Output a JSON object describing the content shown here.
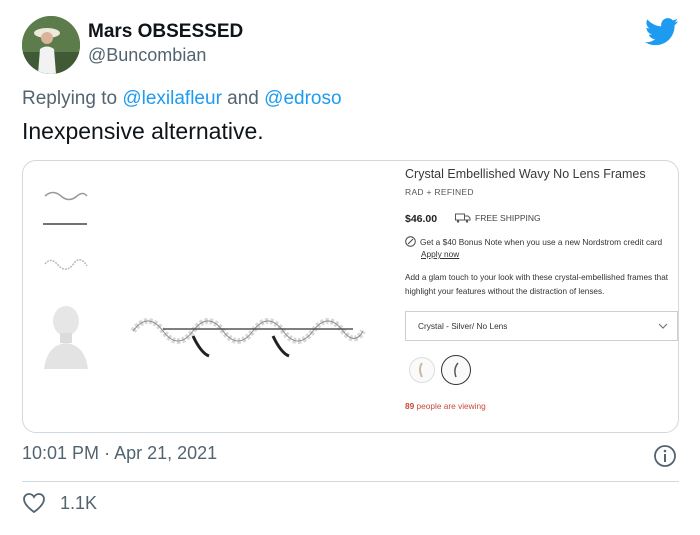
{
  "author": {
    "name": "Mars OBSESSED",
    "handle": "@Buncombian",
    "avatar_icon": "avatar-photo"
  },
  "reply": {
    "prefix": "Replying to",
    "mention1": "@lexilafleur",
    "joiner": "and",
    "mention2": "@edroso"
  },
  "tweet": {
    "text": "Inexpensive alternative."
  },
  "product": {
    "title": "Crystal Embellished Wavy No Lens Frames",
    "brand": "RAD + REFINED",
    "price": "$46.00",
    "shipping": "FREE SHIPPING",
    "bonus": "Get a $40 Bonus Note when you use a new Nordstrom credit card",
    "apply": "Apply now",
    "description": "Add a glam touch to your look with these crystal-embellished frames that highlight your features without the distraction of lenses.",
    "selected_option": "Crystal - Silver/ No Lens",
    "viewing_count": "89",
    "viewing_text": "people are viewing"
  },
  "meta": {
    "time": "10:01 PM",
    "separator": "·",
    "date": "Apr 21, 2021"
  },
  "actions": {
    "like_count": "1.1K"
  },
  "colors": {
    "accent": "#1d9bf0",
    "muted": "#536471",
    "viewing": "#c8493c"
  }
}
